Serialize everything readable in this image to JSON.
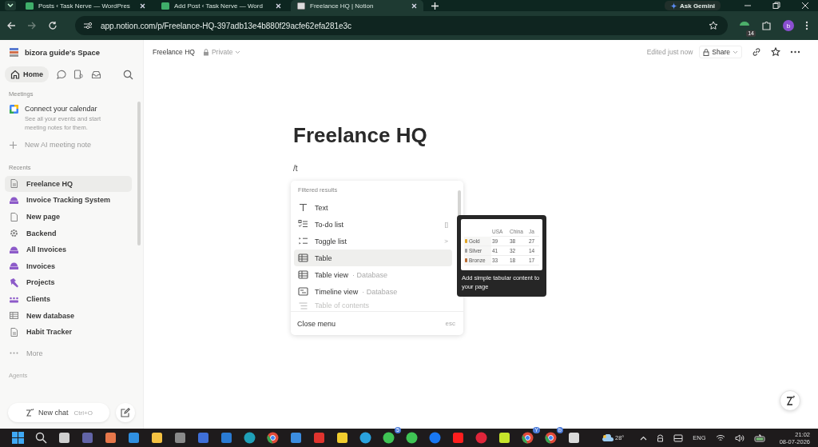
{
  "browser": {
    "tabs": [
      {
        "title": "Posts ‹ Task Nerve — WordPres",
        "selected": false
      },
      {
        "title": "Add Post ‹ Task Nerve — Word",
        "selected": false
      },
      {
        "title": "Freelance HQ | Notion",
        "selected": true
      }
    ],
    "gemini": "Ask Gemini",
    "url": "app.notion.com/p/Freelance-HQ-397adb13e4b880f29acfe62efa281e3c",
    "extension_badge": "14",
    "avatar": "b"
  },
  "sidebar": {
    "workspace": "bizora guide's Space",
    "home": "Home",
    "meetings_label": "Meetings",
    "calendar": {
      "title": "Connect your calendar",
      "description": "See all your events and start meeting notes for them."
    },
    "new_meeting_note": "New AI meeting note",
    "recents_label": "Recents",
    "recents": [
      {
        "label": "Freelance HQ",
        "kind": "doc",
        "selected": true
      },
      {
        "label": "Invoice Tracking System",
        "kind": "database",
        "selected": false
      },
      {
        "label": "New page",
        "kind": "page",
        "selected": false
      },
      {
        "label": "Backend",
        "kind": "gear",
        "selected": false
      },
      {
        "label": "All Invoices",
        "kind": "database",
        "selected": false
      },
      {
        "label": "Invoices",
        "kind": "database",
        "selected": false
      },
      {
        "label": "Projects",
        "kind": "hammer",
        "selected": false
      },
      {
        "label": "Clients",
        "kind": "people",
        "selected": false
      },
      {
        "label": "New database",
        "kind": "table",
        "selected": false
      },
      {
        "label": "Habit Tracker",
        "kind": "doc",
        "selected": false
      }
    ],
    "more": "More",
    "agents_label": "Agents",
    "new_chat": {
      "label": "New chat",
      "shortcut": "Ctrl+O"
    }
  },
  "topbar": {
    "breadcrumb": "Freelance HQ",
    "visibility": "Private",
    "edited": "Edited just now",
    "share": "Share"
  },
  "page": {
    "title": "Freelance HQ",
    "command": "/t"
  },
  "slash_menu": {
    "heading": "Filtered results",
    "items": [
      {
        "label": "Text",
        "kind": "text",
        "selected": false,
        "faded": false
      },
      {
        "label": "To-do list",
        "kind": "todo",
        "shortcut": "[]",
        "selected": false,
        "faded": false
      },
      {
        "label": "Toggle list",
        "kind": "toggle",
        "shortcut": ">",
        "selected": false,
        "faded": false
      },
      {
        "label": "Table",
        "kind": "table",
        "selected": true,
        "faded": false
      },
      {
        "label": "Table view",
        "kind": "table",
        "hint": "· Database",
        "selected": false,
        "faded": false
      },
      {
        "label": "Timeline view",
        "kind": "timeline",
        "hint": "· Database",
        "selected": false,
        "faded": false
      },
      {
        "label": "Table of contents",
        "kind": "toc",
        "selected": false,
        "faded": true
      }
    ],
    "close": {
      "label": "Close menu",
      "shortcut": "esc"
    }
  },
  "preview": {
    "columns": [
      "USA",
      "China",
      "Ja"
    ],
    "rows": [
      {
        "medal": "Gold",
        "color": "#e0a526",
        "values": [
          "39",
          "38",
          "27"
        ]
      },
      {
        "medal": "Silver",
        "color": "#a0a0a0",
        "values": [
          "41",
          "32",
          "14"
        ]
      },
      {
        "medal": "Bronze",
        "color": "#b86b32",
        "values": [
          "33",
          "18",
          "17"
        ]
      }
    ],
    "caption": "Add simple tabular content to your page"
  },
  "taskbar": {
    "apps": [
      {
        "kind": "start"
      },
      {
        "kind": "search"
      },
      {
        "kind": "taskview"
      },
      {
        "kind": "teams"
      },
      {
        "kind": "copilot"
      },
      {
        "kind": "store"
      },
      {
        "kind": "folder"
      },
      {
        "kind": "grey"
      },
      {
        "kind": "blue"
      },
      {
        "kind": "outlook"
      },
      {
        "kind": "edge"
      },
      {
        "kind": "chrome"
      },
      {
        "kind": "letter"
      },
      {
        "kind": "red"
      },
      {
        "kind": "yellow"
      },
      {
        "kind": "telegram"
      },
      {
        "kind": "whatsapp",
        "badge": "5"
      },
      {
        "kind": "whatsapp"
      },
      {
        "kind": "facebook"
      },
      {
        "kind": "youtube"
      },
      {
        "kind": "pinterest"
      },
      {
        "kind": "lime"
      },
      {
        "kind": "chrome",
        "badge": "Y"
      },
      {
        "kind": "chrome",
        "badge": "b"
      },
      {
        "kind": "snip"
      }
    ],
    "weather": "28°",
    "language": "ENG",
    "time": "21:02",
    "date": "08-07-2026"
  }
}
